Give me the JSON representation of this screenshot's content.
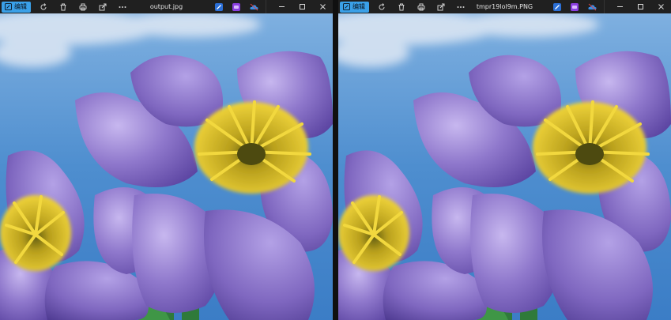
{
  "left_window": {
    "edit_label": "编辑",
    "filename": "output.jpg"
  },
  "right_window": {
    "edit_label": "编辑",
    "filename": "tmpr19lol9m.PNG"
  },
  "toolbar_icons": [
    "edit-icon",
    "rotate-icon",
    "delete-icon",
    "print-icon",
    "share-icon",
    "more-icon"
  ],
  "app_icons": [
    "clipchamp-icon",
    "photos-edit-icon",
    "onedrive-icon"
  ],
  "window_controls": [
    "minimize-icon",
    "maximize-icon",
    "close-icon"
  ],
  "colors": {
    "toolbar_bg": "#202020",
    "accent": "#3aa0e8",
    "sky": "#4f8fd0",
    "petal": "#8b73c7",
    "stamen": "#d8b82a"
  }
}
